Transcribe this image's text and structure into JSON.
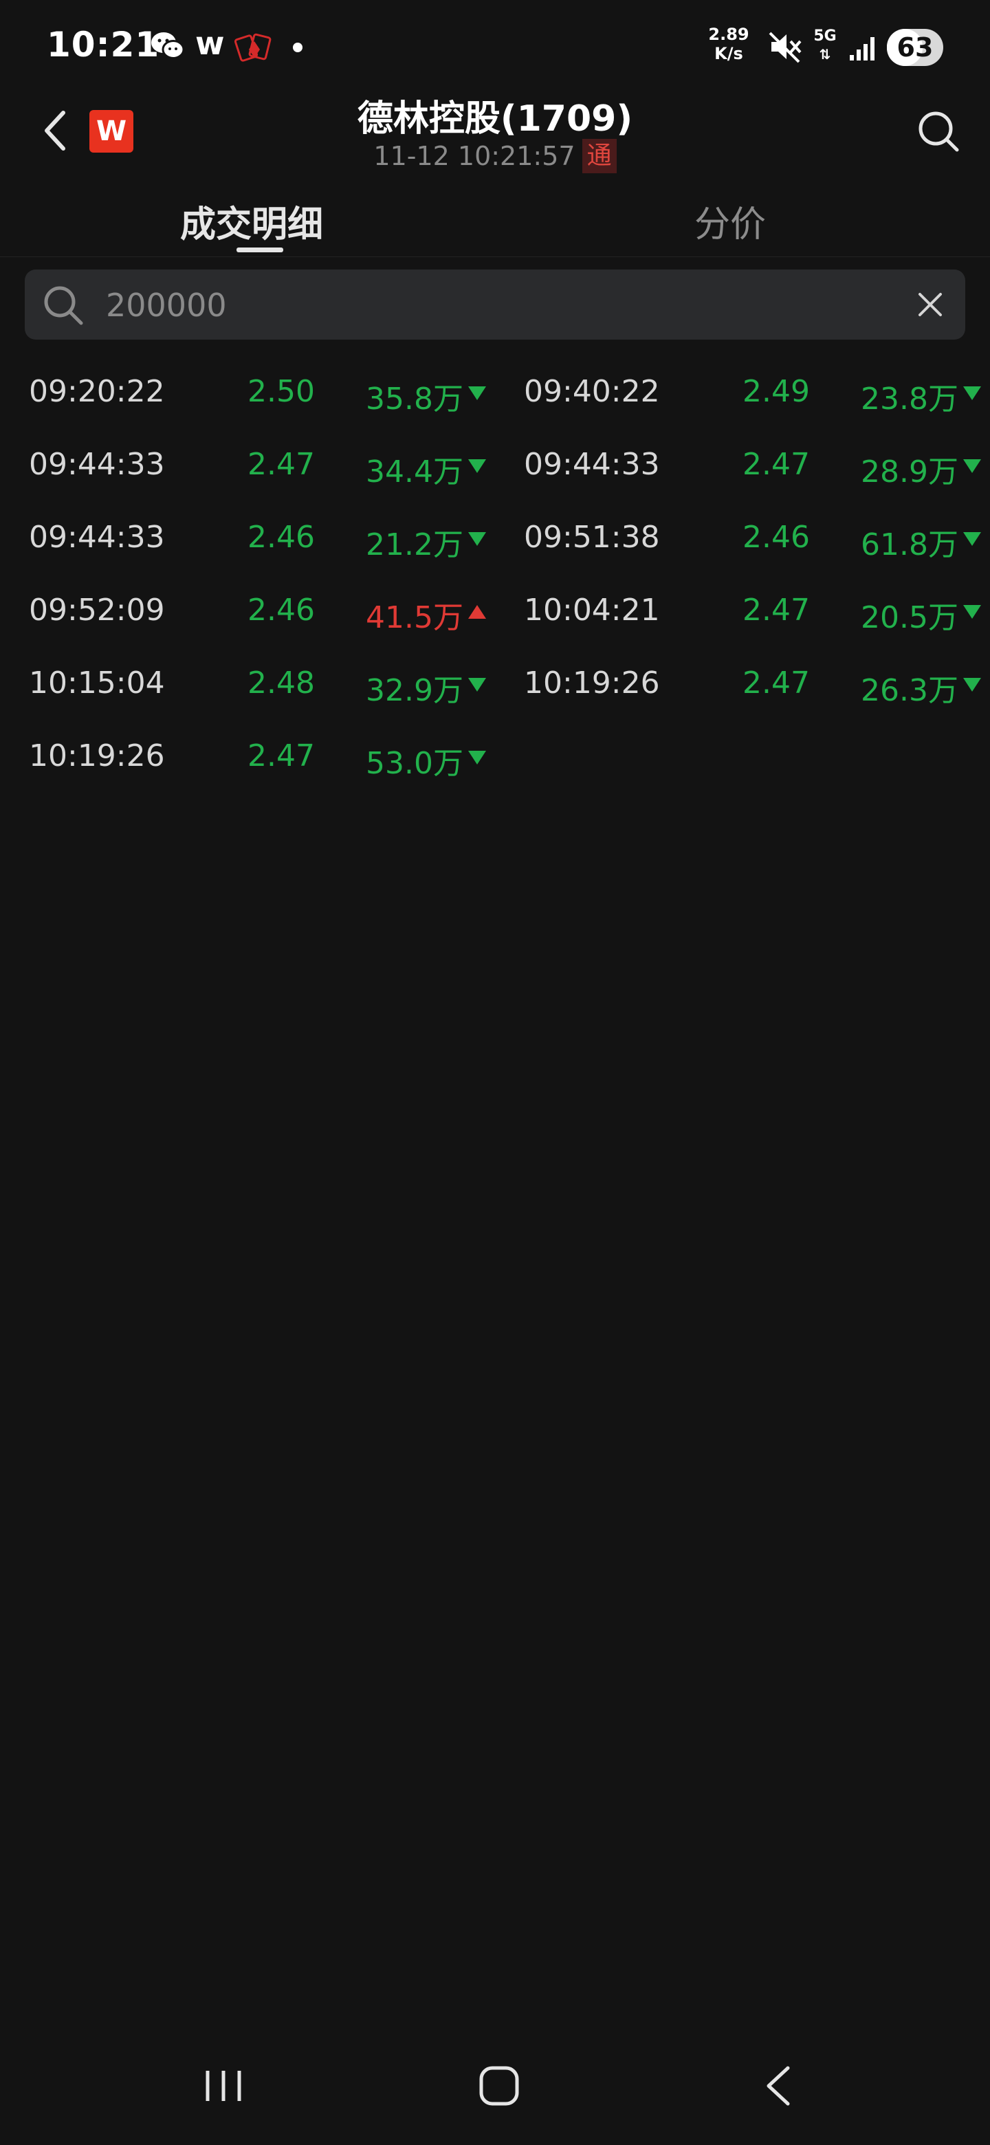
{
  "status_bar": {
    "time": "10:21",
    "w_label": "w",
    "net_speed_value": "2.89",
    "net_speed_unit": "K/s",
    "network": "5G",
    "battery": "63",
    "battery_level_pct": 63
  },
  "header": {
    "logo_letter": "W",
    "title": "德林控股(1709)",
    "subtitle": "11-12 10:21:57",
    "badge": "通"
  },
  "tabs": {
    "active": "成交明细",
    "inactive": "分价"
  },
  "filter": {
    "value": "200000"
  },
  "trades": [
    {
      "time": "09:20:22",
      "price": "2.50",
      "volume": "35.8万",
      "direction": "down"
    },
    {
      "time": "09:40:22",
      "price": "2.49",
      "volume": "23.8万",
      "direction": "down"
    },
    {
      "time": "09:44:33",
      "price": "2.47",
      "volume": "34.4万",
      "direction": "down"
    },
    {
      "time": "09:44:33",
      "price": "2.47",
      "volume": "28.9万",
      "direction": "down"
    },
    {
      "time": "09:44:33",
      "price": "2.46",
      "volume": "21.2万",
      "direction": "down"
    },
    {
      "time": "09:51:38",
      "price": "2.46",
      "volume": "61.8万",
      "direction": "down"
    },
    {
      "time": "09:52:09",
      "price": "2.46",
      "volume": "41.5万",
      "direction": "up"
    },
    {
      "time": "10:04:21",
      "price": "2.47",
      "volume": "20.5万",
      "direction": "down"
    },
    {
      "time": "10:15:04",
      "price": "2.48",
      "volume": "32.9万",
      "direction": "down"
    },
    {
      "time": "10:19:26",
      "price": "2.47",
      "volume": "26.3万",
      "direction": "down"
    },
    {
      "time": "10:19:26",
      "price": "2.47",
      "volume": "53.0万",
      "direction": "down"
    }
  ],
  "colors": {
    "background": "#131313",
    "down": "#22b14c",
    "up": "#e03a35",
    "logo": "#e8321f"
  },
  "icons": {
    "back": "chevron-left-icon",
    "search": "search-icon",
    "clear": "close-icon",
    "nav_recent": "recent-apps-icon",
    "nav_home": "home-icon",
    "nav_back": "nav-back-icon"
  }
}
